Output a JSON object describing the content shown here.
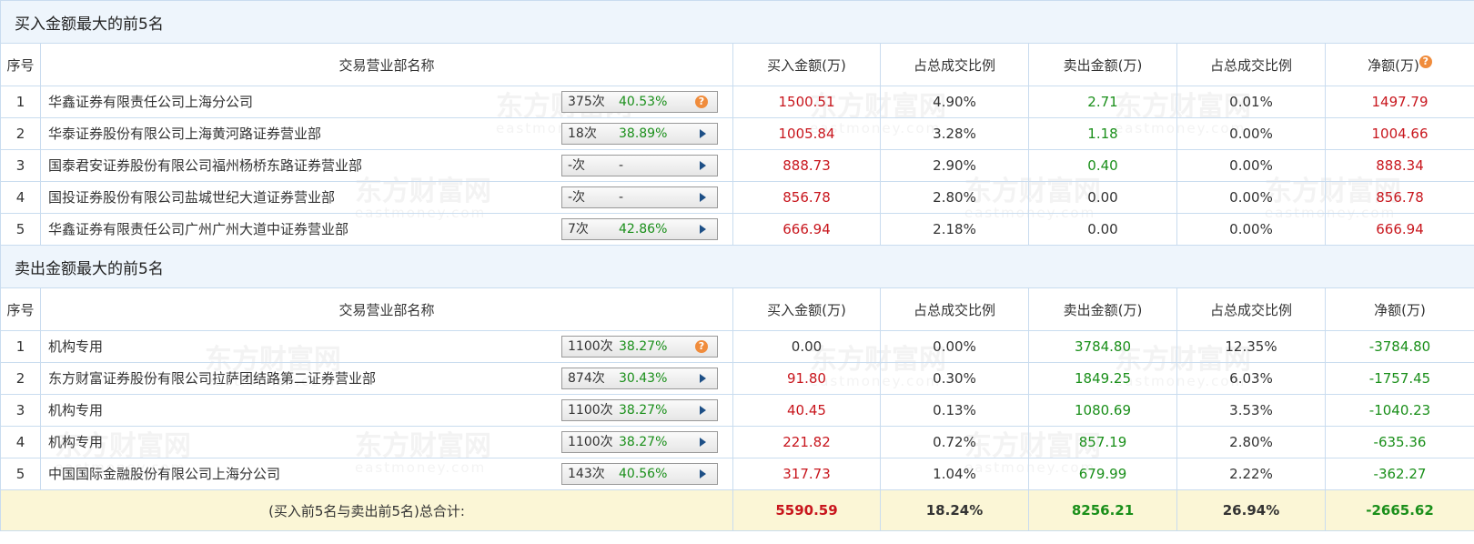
{
  "buy_section": {
    "title": "买入金额最大的前5名",
    "headers": [
      "序号",
      "交易营业部名称",
      "买入金额(万)",
      "占总成交比例",
      "卖出金额(万)",
      "占总成交比例",
      "净额(万)"
    ],
    "rows": [
      {
        "idx": "1",
        "name": "华鑫证券有限责任公司上海分公司",
        "count": "375次",
        "rate": "40.53%",
        "buy": "1500.51",
        "buy_pct": "4.90%",
        "sell": "2.71",
        "sell_pct": "0.01%",
        "net": "1497.79",
        "icon": "question-icon"
      },
      {
        "idx": "2",
        "name": "华泰证券股份有限公司上海黄河路证券营业部",
        "count": "18次",
        "rate": "38.89%",
        "buy": "1005.84",
        "buy_pct": "3.28%",
        "sell": "1.18",
        "sell_pct": "0.00%",
        "net": "1004.66",
        "icon": "play-arrow-icon"
      },
      {
        "idx": "3",
        "name": "国泰君安证券股份有限公司福州杨桥东路证券营业部",
        "count": "-次",
        "rate": "-",
        "buy": "888.73",
        "buy_pct": "2.90%",
        "sell": "0.40",
        "sell_pct": "0.00%",
        "net": "888.34",
        "icon": "play-arrow-icon"
      },
      {
        "idx": "4",
        "name": "国投证券股份有限公司盐城世纪大道证券营业部",
        "count": "-次",
        "rate": "-",
        "buy": "856.78",
        "buy_pct": "2.80%",
        "sell": "0.00",
        "sell_pct": "0.00%",
        "net": "856.78",
        "icon": "play-arrow-icon"
      },
      {
        "idx": "5",
        "name": "华鑫证券有限责任公司广州广州大道中证券营业部",
        "count": "7次",
        "rate": "42.86%",
        "buy": "666.94",
        "buy_pct": "2.18%",
        "sell": "0.00",
        "sell_pct": "0.00%",
        "net": "666.94",
        "icon": "play-arrow-icon"
      }
    ]
  },
  "sell_section": {
    "title": "卖出金额最大的前5名",
    "headers": [
      "序号",
      "交易营业部名称",
      "买入金额(万)",
      "占总成交比例",
      "卖出金额(万)",
      "占总成交比例",
      "净额(万)"
    ],
    "rows": [
      {
        "idx": "1",
        "name": "机构专用",
        "count": "1100次",
        "rate": "38.27%",
        "buy": "0.00",
        "buy_pct": "0.00%",
        "sell": "3784.80",
        "sell_pct": "12.35%",
        "net": "-3784.80",
        "icon": "question-icon"
      },
      {
        "idx": "2",
        "name": "东方财富证券股份有限公司拉萨团结路第二证券营业部",
        "count": "874次",
        "rate": "30.43%",
        "buy": "91.80",
        "buy_pct": "0.30%",
        "sell": "1849.25",
        "sell_pct": "6.03%",
        "net": "-1757.45",
        "icon": "play-arrow-icon"
      },
      {
        "idx": "3",
        "name": "机构专用",
        "count": "1100次",
        "rate": "38.27%",
        "buy": "40.45",
        "buy_pct": "0.13%",
        "sell": "1080.69",
        "sell_pct": "3.53%",
        "net": "-1040.23",
        "icon": "play-arrow-icon"
      },
      {
        "idx": "4",
        "name": "机构专用",
        "count": "1100次",
        "rate": "38.27%",
        "buy": "221.82",
        "buy_pct": "0.72%",
        "sell": "857.19",
        "sell_pct": "2.80%",
        "net": "-635.36",
        "icon": "play-arrow-icon"
      },
      {
        "idx": "5",
        "name": "中国国际金融股份有限公司上海分公司",
        "count": "143次",
        "rate": "40.56%",
        "buy": "317.73",
        "buy_pct": "1.04%",
        "sell": "679.99",
        "sell_pct": "2.22%",
        "net": "-362.27",
        "icon": "play-arrow-icon"
      }
    ]
  },
  "total": {
    "label": "(买入前5名与卖出前5名)总合计:",
    "buy": "5590.59",
    "buy_pct": "18.24%",
    "sell": "8256.21",
    "sell_pct": "26.94%",
    "net": "-2665.62"
  },
  "watermark": {
    "text": "东方财富网",
    "sub": "eastmoney.com"
  },
  "colors": {
    "buy": "#c8161d",
    "sell": "#1a8f1a",
    "section_bg": "#eef5fc",
    "total_bg": "#fbf6d6",
    "border": "#c9dcef"
  }
}
